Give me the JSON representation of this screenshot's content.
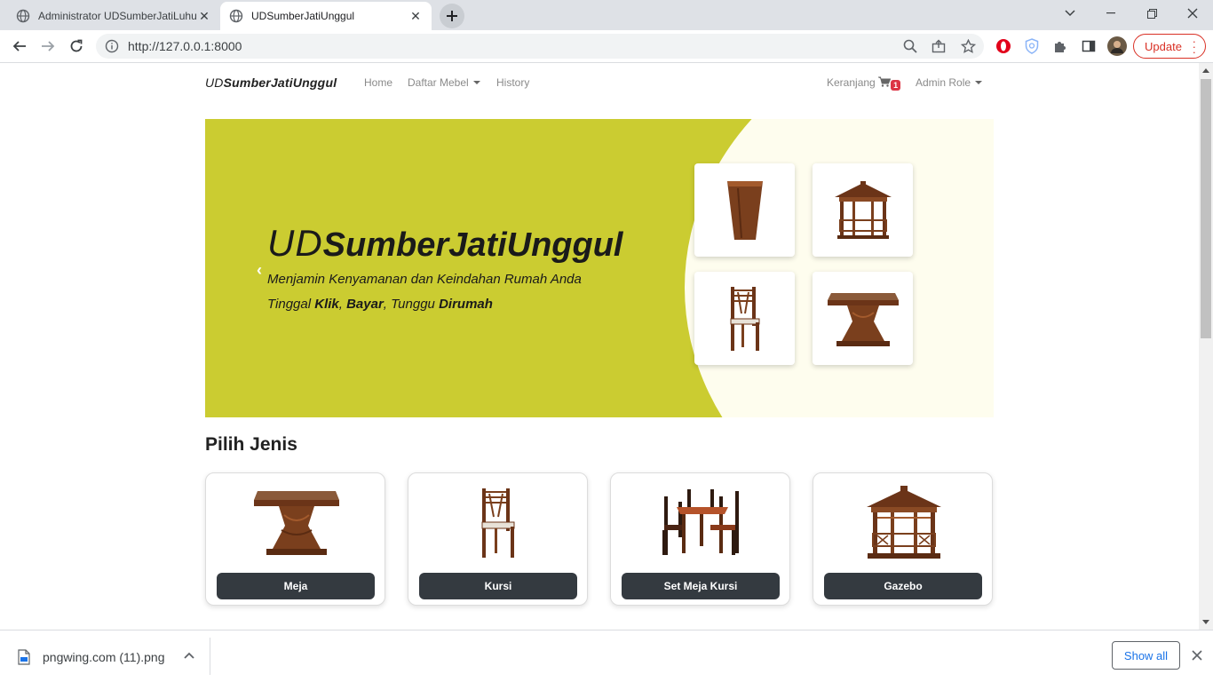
{
  "browser": {
    "tabs": [
      {
        "title": "Administrator UDSumberJatiLuhur",
        "active": false
      },
      {
        "title": "UDSumberJatiUnggul",
        "active": true
      }
    ],
    "url": "http://127.0.0.1:8000",
    "update_label": "Update"
  },
  "site": {
    "brand_prefix": "UD",
    "brand_name": "SumberJatiUnggul",
    "nav": {
      "home": "Home",
      "catalog": "Daftar Mebel",
      "history": "History",
      "cart": "Keranjang",
      "cart_count": "1",
      "role": "Admin Role"
    },
    "hero": {
      "title_prefix": "UD",
      "title_name": "SumberJatiUnggul",
      "line1": "Menjamin Kenyamanan dan Keindahan Rumah Anda",
      "line2_a": "Tinggal ",
      "line2_klik": "Klik",
      "line2_b": ", ",
      "line2_bayar": "Bayar",
      "line2_c": ", Tunggu ",
      "line2_dirumah": "Dirumah",
      "prev_arrow": "‹"
    },
    "section_title": "Pilih Jenis",
    "categories": [
      {
        "label": "Meja",
        "icon": "table-icon"
      },
      {
        "label": "Kursi",
        "icon": "chair-icon"
      },
      {
        "label": "Set Meja Kursi",
        "icon": "dining-set-icon"
      },
      {
        "label": "Gazebo",
        "icon": "gazebo-icon"
      }
    ]
  },
  "downloads": {
    "filename": "pngwing.com (11).png",
    "show_all": "Show all"
  },
  "colors": {
    "hero_green": "#cbcc31",
    "hero_cream": "#fefdee",
    "button_dark": "#343a40",
    "badge_red": "#dc3545",
    "wood": "#7a3f1d"
  }
}
